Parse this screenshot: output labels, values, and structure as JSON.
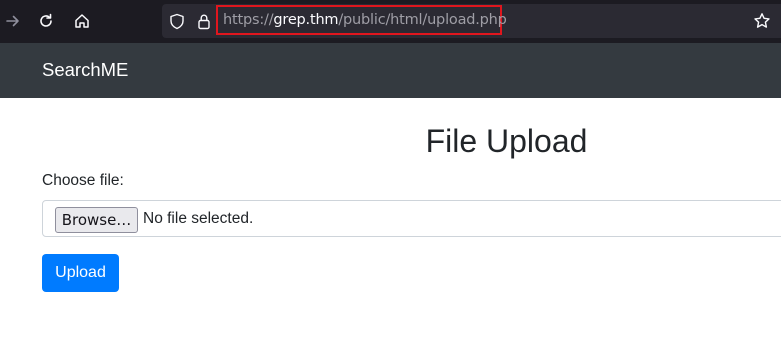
{
  "browser": {
    "url_scheme": "https://",
    "url_host": "grep.thm",
    "url_path": "/public/html/upload.php"
  },
  "navbar": {
    "brand": "SearchME"
  },
  "main": {
    "title": "File Upload",
    "file_label": "Choose file:",
    "browse_label": "Browse…",
    "file_status": "No file selected.",
    "upload_label": "Upload"
  },
  "colors": {
    "chrome_bg": "#1c1b22",
    "navbar_bg": "#343a40",
    "primary": "#007bff",
    "highlight": "#e0161e"
  },
  "icons": [
    "forward-icon",
    "reload-icon",
    "home-icon",
    "shield-icon",
    "lock-icon",
    "bookmark-star-icon"
  ]
}
